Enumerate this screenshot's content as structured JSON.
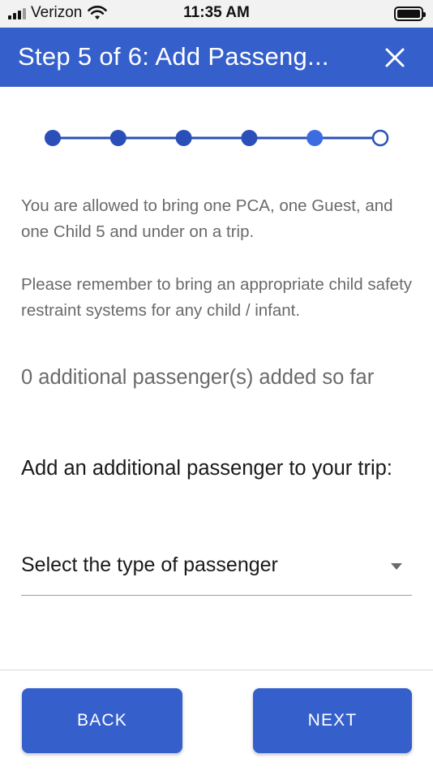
{
  "status_bar": {
    "carrier": "Verizon",
    "time": "11:35 AM"
  },
  "header": {
    "title": "Step 5 of 6: Add Passeng...",
    "close_icon": "close-icon",
    "background_color": "#3560cc"
  },
  "stepper": {
    "total_steps": 6,
    "current_step": 5,
    "completed_color": "#2a4fb8",
    "current_color": "#3d6be0"
  },
  "info": {
    "allowed_text": "You are allowed to bring one PCA, one Guest, and one Child 5 and under on a trip.",
    "safety_text": "Please remember to bring an appropriate child safety restraint systems for any child / infant."
  },
  "passenger_count_text": "0 additional passenger(s) added so far",
  "add_passenger_heading": "Add an additional passenger to your trip:",
  "passenger_type_select": {
    "value": "Select the type of passenger",
    "icon": "chevron-down-icon"
  },
  "footer": {
    "back_label": "BACK",
    "next_label": "NEXT"
  }
}
